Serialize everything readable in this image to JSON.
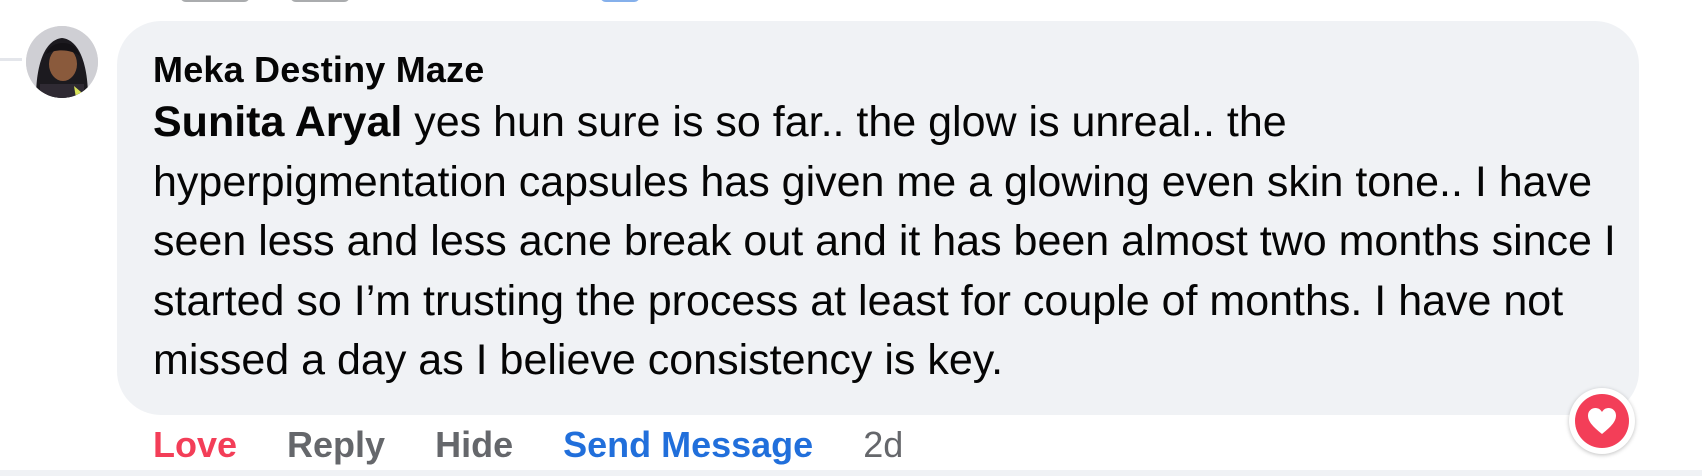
{
  "comment": {
    "author": "Meka Destiny Maze",
    "mention": "Sunita Aryal",
    "text": " yes hun sure is so far.. the glow is unreal.. the hyperpigmentation capsules has given me a glowing even skin tone.. I have seen less and less acne break out and it has been almost two months since I started so I’m trusting the process at least for couple of months. I have not missed a day as I believe consistency is key.",
    "timestamp": "2d",
    "reaction": "love-heart-icon"
  },
  "actions": {
    "love": "Love",
    "reply": "Reply",
    "hide": "Hide",
    "send_message": "Send Message"
  },
  "colors": {
    "love": "#f33e58",
    "link_blue": "#216fdb",
    "secondary_text": "#65676b",
    "bubble_bg": "#f0f2f5"
  }
}
